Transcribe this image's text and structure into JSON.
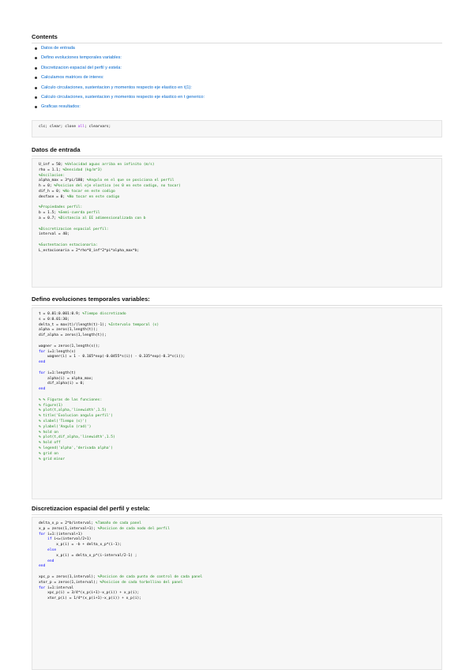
{
  "contents": {
    "heading": "Contents",
    "items": [
      "Datos de entrada",
      "Defino evoluciones temporales variables:",
      "Discretizacion espacial del perfil y estela:",
      "Calculamos matrices de interes:",
      "Calculo circulaciones, sustentacion y momentos respecto eje elastico en t(1):",
      "Calculo circulaciones, sustentacion y momentos respecto eje elastico en t generico:",
      "Graficas resultados:"
    ]
  },
  "preamble_code": [
    [
      [
        "",
        "clc; clear; close "
      ],
      [
        "st",
        "all"
      ],
      [
        "",
        "; clearvars;"
      ]
    ]
  ],
  "sections": [
    {
      "heading": "Datos de entrada",
      "code": [
        [
          [
            "",
            "U_inf = 50; "
          ],
          [
            "cm",
            "%Velocidad aguas arriba en infinito (m/s)"
          ]
        ],
        [
          [
            "",
            "rho = 1.1; "
          ],
          [
            "cm",
            "%Densidad (kg/m^3)"
          ]
        ],
        [
          [
            "cm",
            "%Oscilacion:"
          ]
        ],
        [
          [
            "",
            "alpha_max = 3*pi/180; "
          ],
          [
            "cm",
            "%Angulo en el que se posiciona el perfil"
          ]
        ],
        [
          [
            "",
            "h = 0; "
          ],
          [
            "cm",
            "%Posicion del eje elastico (es 0 en este codigo, no tocar)"
          ]
        ],
        [
          [
            "",
            "dif_h = 0; "
          ],
          [
            "cm",
            "%No tocar en este codigo"
          ]
        ],
        [
          [
            "",
            "desfase = 0; "
          ],
          [
            "cm",
            "%No tocar en este codigo"
          ]
        ],
        [
          [
            "",
            ""
          ]
        ],
        [
          [
            "cm",
            "%Propiedades perfil:"
          ]
        ],
        [
          [
            "",
            "b = 1.5; "
          ],
          [
            "cm",
            "%Semi-cuerda perfil"
          ]
        ],
        [
          [
            "",
            "a = 0.7; "
          ],
          [
            "cm",
            "%Distancia al EE adimensionalizada con b"
          ]
        ],
        [
          [
            "",
            ""
          ]
        ],
        [
          [
            "cm",
            "%Discretizacion espacial perfil:"
          ]
        ],
        [
          [
            "",
            "interval = 40;"
          ]
        ],
        [
          [
            "",
            ""
          ]
        ],
        [
          [
            "cm",
            "%Sustentacion estacionaria:"
          ]
        ],
        [
          [
            "",
            "L_estacionaria = 2*rho*U_inf^2*pi*alpha_max*b;"
          ]
        ]
      ]
    },
    {
      "heading": "Defino evoluciones temporales variables:",
      "code": [
        [
          [
            "",
            "t = 0.01:0.001:0.9; "
          ],
          [
            "cm",
            "%Tiempo discretizado"
          ]
        ],
        [
          [
            "",
            "s = 0:0.01:30;"
          ]
        ],
        [
          [
            "",
            "delta_t = max(t)/(length(t)-1); "
          ],
          [
            "cm",
            "%Intervalo temporal (s)"
          ]
        ],
        [
          [
            "",
            "alpha = zeros(1,length(t));"
          ]
        ],
        [
          [
            "",
            "dif_alpha = zeros(1,length(t));"
          ]
        ],
        [
          [
            "",
            ""
          ]
        ],
        [
          [
            "",
            "wagner = zeros(1,length(s));"
          ]
        ],
        [
          [
            "kw",
            "for"
          ],
          [
            "",
            " i=1:length(s)"
          ]
        ],
        [
          [
            "",
            "    wagner(i) = 1 - 0.165*exp(-0.0455*s(i)) - 0.335*exp(-0.3*s(i));"
          ]
        ],
        [
          [
            "kw",
            "end"
          ]
        ],
        [
          [
            "",
            ""
          ]
        ],
        [
          [
            "kw",
            "for"
          ],
          [
            "",
            " i=1:length(t)"
          ]
        ],
        [
          [
            "",
            "    alpha(i) = alpha_max;"
          ]
        ],
        [
          [
            "",
            "    dif_alpha(i) = 0;"
          ]
        ],
        [
          [
            "kw",
            "end"
          ]
        ],
        [
          [
            "",
            ""
          ]
        ],
        [
          [
            "cm",
            "% % Figuras de las funciones:"
          ]
        ],
        [
          [
            "cm",
            "% figure(1)"
          ]
        ],
        [
          [
            "cm",
            "% plot(t,alpha,'linewidth',1.5)"
          ]
        ],
        [
          [
            "cm",
            "% title('Evolucion angulo perfil')"
          ]
        ],
        [
          [
            "cm",
            "% xlabel('Tiempo (s)')"
          ]
        ],
        [
          [
            "cm",
            "% ylabel('Angulo (rad)')"
          ]
        ],
        [
          [
            "cm",
            "% hold on"
          ]
        ],
        [
          [
            "cm",
            "% plot(t,dif_alpha,'linewidth',1.5)"
          ]
        ],
        [
          [
            "cm",
            "% hold off"
          ]
        ],
        [
          [
            "cm",
            "% legend('alpha','derivada alpha')"
          ]
        ],
        [
          [
            "cm",
            "% grid on"
          ]
        ],
        [
          [
            "cm",
            "% grid minor"
          ]
        ]
      ]
    },
    {
      "heading": "Discretizacion espacial del perfil y estela:",
      "code": [
        [
          [
            "",
            "delta_x_p = 2*b/interval; "
          ],
          [
            "cm",
            "%Tamaño de cada panel"
          ]
        ],
        [
          [
            "",
            "x_p = zeros(1,interval+1); "
          ],
          [
            "cm",
            "%Posicion de cada nodo del perfil"
          ]
        ],
        [
          [
            "kw",
            "for"
          ],
          [
            "",
            " i=1:(interval+1)"
          ]
        ],
        [
          [
            "",
            "    "
          ],
          [
            "kw",
            "if"
          ],
          [
            "",
            " i<=(interval/2+1)"
          ]
        ],
        [
          [
            "",
            "        x_p(i) = -b + delta_x_p*(i-1);"
          ]
        ],
        [
          [
            "",
            "    "
          ],
          [
            "kw",
            "else"
          ]
        ],
        [
          [
            "",
            "        x_p(i) = delta_x_p*(i-interval/2-1) ;"
          ]
        ],
        [
          [
            "",
            "    "
          ],
          [
            "kw",
            "end"
          ]
        ],
        [
          [
            "kw",
            "end"
          ]
        ],
        [
          [
            "",
            ""
          ]
        ],
        [
          [
            "",
            "xpc_p = zeros(1,interval); "
          ],
          [
            "cm",
            "%Posicion de cada punto de control de cada panel"
          ]
        ],
        [
          [
            "",
            "xtor_p = zeros(1,interval); "
          ],
          [
            "cm",
            "%Posicion de cada torbellino del panel"
          ]
        ],
        [
          [
            "kw",
            "for"
          ],
          [
            "",
            " i=1:interval"
          ]
        ],
        [
          [
            "",
            "    xpc_p(i) = 3/4*(x_p(i+1)-x_p(i)) + x_p(i);"
          ]
        ],
        [
          [
            "",
            "    xtor_p(i) = 1/4*(x_p(i+1)-x_p(i)) + x_p(i);"
          ]
        ]
      ]
    }
  ]
}
